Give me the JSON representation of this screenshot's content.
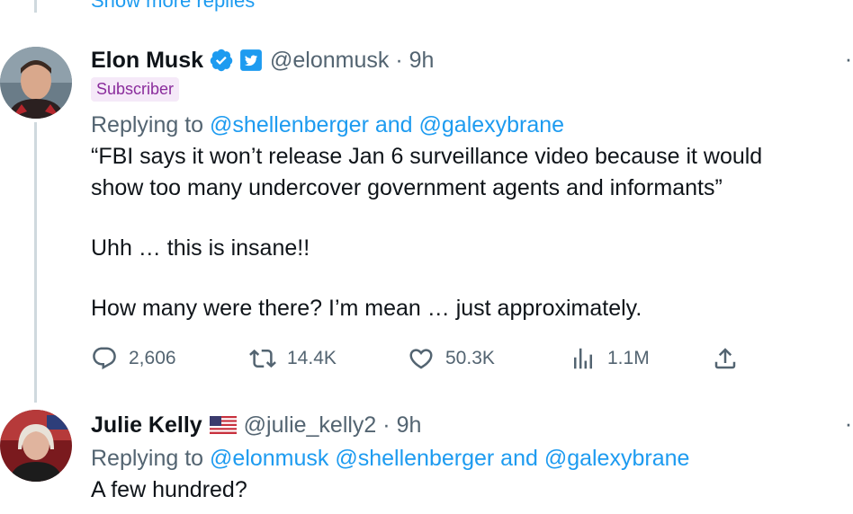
{
  "thread": {
    "show_more_replies": "Show more replies"
  },
  "tweets": [
    {
      "name": "Elon Musk",
      "handle": "@elonmusk",
      "time": "9h",
      "badge": "Subscriber",
      "replying_prefix": "Replying to",
      "replying_mentions": "@shellenberger and @galexybrane",
      "text_lines": [
        "“FBI says it won’t release Jan 6 surveillance video because it would",
        "show too many undercover government agents and informants”",
        "Uhh … this is insane!!",
        "How many were there? I’m mean … just approximately."
      ],
      "stats": {
        "replies": "2,606",
        "retweets": "14.4K",
        "likes": "50.3K",
        "views": "1.1M"
      },
      "icons": [
        "verified-badge-icon",
        "twitter-square-icon",
        "reply-icon",
        "retweet-icon",
        "like-icon",
        "views-icon",
        "share-icon",
        "more-icon"
      ]
    },
    {
      "name": "Julie Kelly",
      "handle": "@julie_kelly2",
      "time": "9h",
      "replying_prefix": "Replying to",
      "replying_mentions": "@elonmusk @shellenberger and @galexybrane",
      "text_lines": [
        "A few hundred?"
      ],
      "icons": [
        "us-flag-icon",
        "more-icon"
      ]
    }
  ],
  "colors": {
    "link": "#1d9bf0",
    "secondary_text": "#536471",
    "primary_text": "#0f1419",
    "subscriber_bg": "#f5e9f8",
    "subscriber_text": "#8a2c9c"
  }
}
